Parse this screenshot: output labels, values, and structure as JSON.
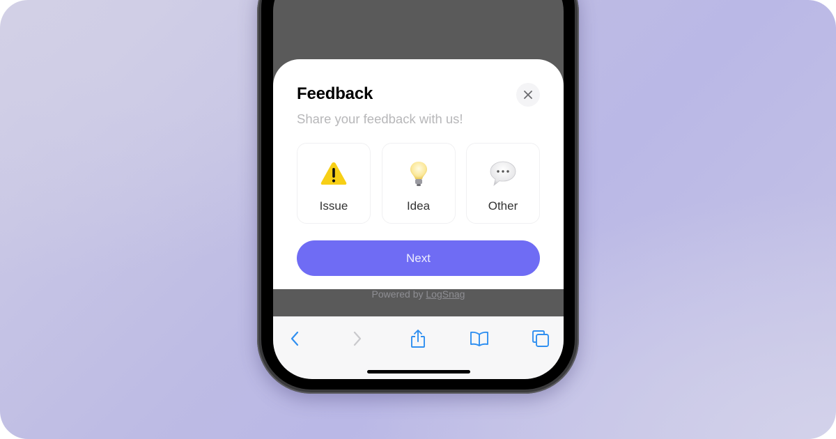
{
  "feedback_sheet": {
    "title": "Feedback",
    "subtitle": "Share your feedback with us!",
    "close_icon": "close-icon",
    "options": [
      {
        "label": "Issue",
        "icon": "warning-icon"
      },
      {
        "label": "Idea",
        "icon": "lightbulb-icon"
      },
      {
        "label": "Other",
        "icon": "speech-bubble-icon"
      }
    ],
    "next_label": "Next",
    "powered_by_prefix": "Powered by ",
    "powered_by_link": "LogSnag",
    "accent_color": "#6f6cf4"
  },
  "browser_toolbar": {
    "items": [
      {
        "name": "back",
        "icon": "chevron-left-icon",
        "enabled": true
      },
      {
        "name": "forward",
        "icon": "chevron-right-icon",
        "enabled": false
      },
      {
        "name": "share",
        "icon": "share-icon",
        "enabled": true
      },
      {
        "name": "bookmarks",
        "icon": "book-icon",
        "enabled": true
      },
      {
        "name": "tabs",
        "icon": "tabs-icon",
        "enabled": true
      }
    ],
    "icon_color": "#2f8ff0"
  }
}
